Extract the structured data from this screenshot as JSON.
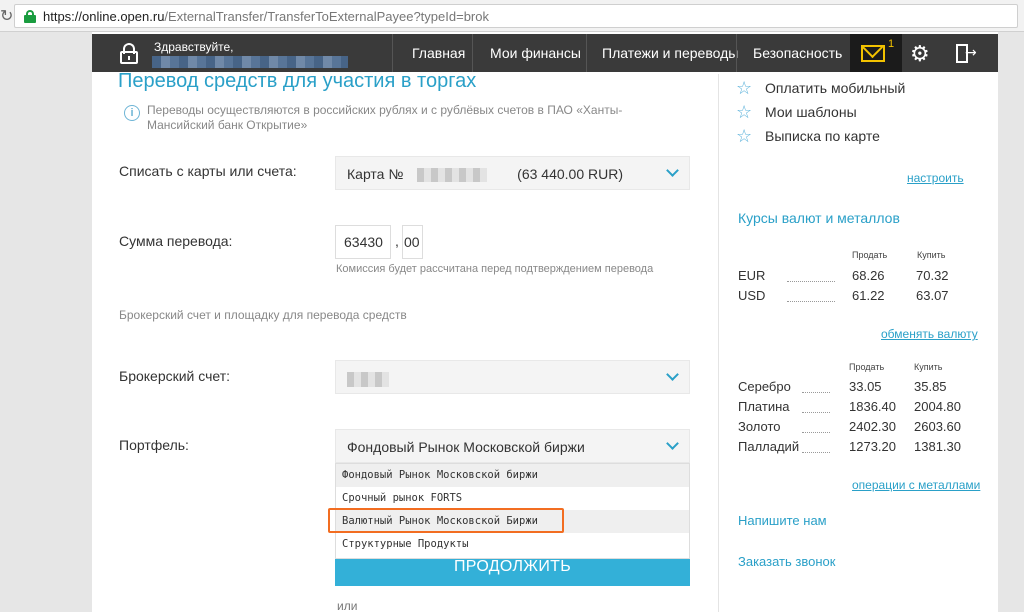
{
  "browser": {
    "url_host": "https://online.open.ru",
    "url_path": "/ExternalTransfer/TransferToExternalPayee?typeId=brok"
  },
  "nav": {
    "greeting": "Здравствуйте,",
    "items": [
      "Главная",
      "Мои финансы",
      "Платежи и переводы",
      "Безопасность"
    ],
    "mail_count": "1"
  },
  "form": {
    "title": "Перевод средств для участия в торгах",
    "info": "Переводы осуществляются в российских рублях и с рублёвых счетов в ПАО «Ханты-Мансийский банк Открытие»",
    "debit_label": "Списать с карты или счета:",
    "card_prefix": "Карта №",
    "card_balance": "(63 440.00 RUR)",
    "amount_label": "Сумма перевода:",
    "amount_int": "63430",
    "amount_frac": "00",
    "comma": ",",
    "commission_hint": "Комиссия будет рассчитана перед подтверждением перевода",
    "broker_note": "Брокерский счет и площадку для перевода средств",
    "broker_label": "Брокерский счет:",
    "portfolio_label": "Портфель:",
    "portfolio_selected": "Фондовый Рынок Московской биржи",
    "portfolio_options": [
      "Фондовый Рынок Московской биржи",
      "Срочный рынок FORTS",
      "Валютный Рынок Московской Биржи",
      "Структурные Продукты"
    ],
    "continue_label": "ПРОДОЛЖИТЬ",
    "or_label": "или"
  },
  "sidebar": {
    "quick_links": [
      "Оплатить мобильный",
      "Мои шаблоны",
      "Выписка по карте"
    ],
    "configure": "настроить",
    "rates_title": "Курсы валют и металлов",
    "col_sell": "Продать",
    "col_buy": "Купить",
    "currencies": [
      {
        "name": "EUR",
        "sell": "68.26",
        "buy": "70.32"
      },
      {
        "name": "USD",
        "sell": "61.22",
        "buy": "63.07"
      }
    ],
    "exchange_link": "обменять валюту",
    "metals": [
      {
        "name": "Серебро",
        "sell": "33.05",
        "buy": "35.85"
      },
      {
        "name": "Платина",
        "sell": "1836.40",
        "buy": "2004.80"
      },
      {
        "name": "Золото",
        "sell": "2402.30",
        "buy": "2603.60"
      },
      {
        "name": "Палладий",
        "sell": "1273.20",
        "buy": "1381.30"
      }
    ],
    "metals_link": "операции с металлами",
    "write_us": "Напишите нам",
    "call_back": "Заказать звонок"
  }
}
